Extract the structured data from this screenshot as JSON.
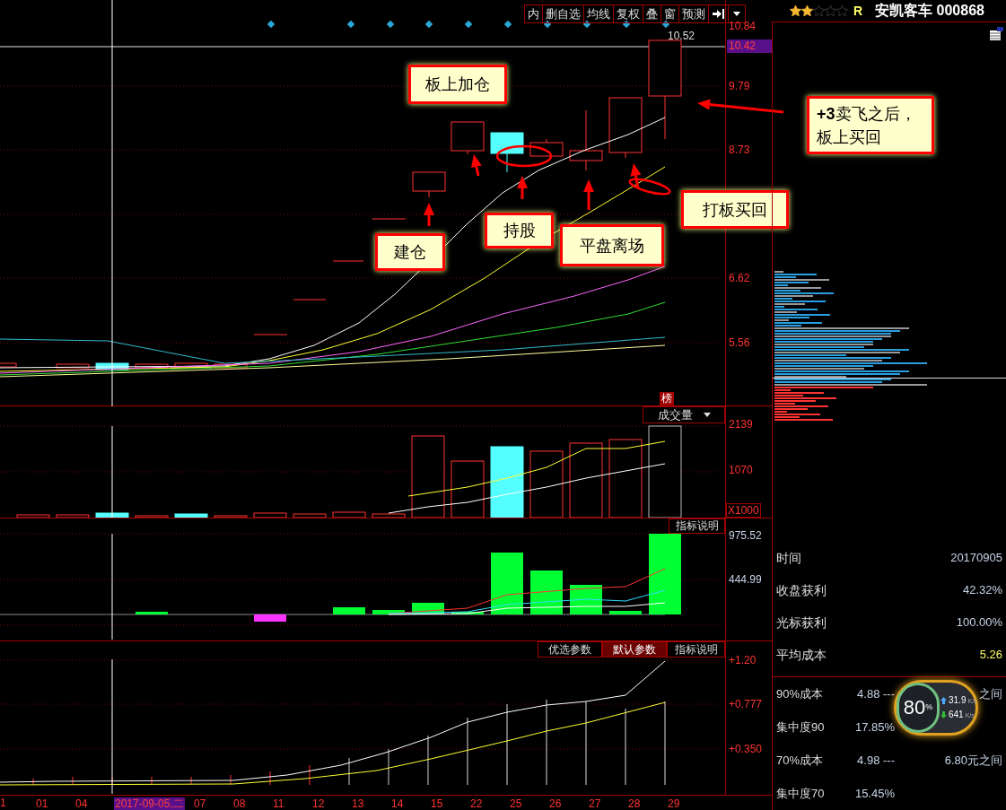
{
  "toolbar": {
    "buttons": [
      "内",
      "删自选",
      "均线",
      "复权",
      "叠",
      "窗",
      "预测"
    ]
  },
  "main_chart": {
    "price_axis": [
      "10.84",
      "9.79",
      "8.73",
      "6.62",
      "5.56"
    ],
    "cursor_price": "10.42",
    "high_marker": "10.52",
    "badge": "榜",
    "annotations": [
      {
        "text": "板上加仓"
      },
      {
        "text": "建仓"
      },
      {
        "text": "持股"
      },
      {
        "text": "平盘离场"
      },
      {
        "text": "打板买回"
      },
      {
        "text": "**+3**卖飞之后，板上买回"
      }
    ]
  },
  "volume_panel": {
    "selector": "成交量",
    "axis": [
      "2139",
      "1070"
    ],
    "unit": "X1000"
  },
  "indicator_panel": {
    "button": "指标说明",
    "axis": [
      "975.52",
      "444.99"
    ]
  },
  "lower_panel": {
    "tabs": [
      {
        "label": "优选参数",
        "selected": false
      },
      {
        "label": "默认参数",
        "selected": true
      }
    ],
    "button": "指标说明",
    "axis": [
      "+1.20",
      "+0.777",
      "+0.350"
    ]
  },
  "date_axis": {
    "labels": [
      {
        "kind": "edge",
        "text": "1"
      },
      {
        "kind": "tick",
        "text": "01"
      },
      {
        "kind": "tick",
        "text": "04"
      },
      {
        "kind": "cursor",
        "text": "2017-09-05,二"
      },
      {
        "kind": "tick",
        "text": "07"
      },
      {
        "kind": "tick",
        "text": "08"
      },
      {
        "kind": "tick",
        "text": "11"
      },
      {
        "kind": "tick",
        "text": "12"
      },
      {
        "kind": "tick",
        "text": "13"
      },
      {
        "kind": "tick",
        "text": "14"
      },
      {
        "kind": "tick",
        "text": "15"
      },
      {
        "kind": "tick",
        "text": "22"
      },
      {
        "kind": "tick",
        "text": "25"
      },
      {
        "kind": "tick",
        "text": "26"
      },
      {
        "kind": "tick",
        "text": "27"
      },
      {
        "kind": "tick",
        "text": "28"
      },
      {
        "kind": "tick",
        "text": "29"
      }
    ]
  },
  "stock": {
    "stars": 2,
    "rating": "R",
    "name": "安凯客车 000868"
  },
  "chip_stats": {
    "rows": [
      {
        "label": "时间",
        "value": "20170905",
        "highlight": false
      },
      {
        "label": "收盘获利",
        "value": "42.32%",
        "highlight": false
      },
      {
        "label": "光标获利",
        "value": "100.00%",
        "highlight": false
      },
      {
        "label": "平均成本",
        "value": "5.26",
        "highlight": true
      }
    ],
    "cost_rows": [
      {
        "label": "90%成本",
        "value": "4.88 ---",
        "extra": "之间"
      },
      {
        "label": "集中度90",
        "value": "17.85%"
      },
      {
        "label": "70%成本",
        "value": "4.98 ---",
        "extra": "6.80元之间"
      },
      {
        "label": "集中度70",
        "value": "15.45%"
      }
    ]
  },
  "speed_widget": {
    "percent": "80",
    "percent_unit": "%",
    "upload": "31.9",
    "upload_unit": "K/s",
    "download": "641",
    "download_unit": "K/s"
  }
}
